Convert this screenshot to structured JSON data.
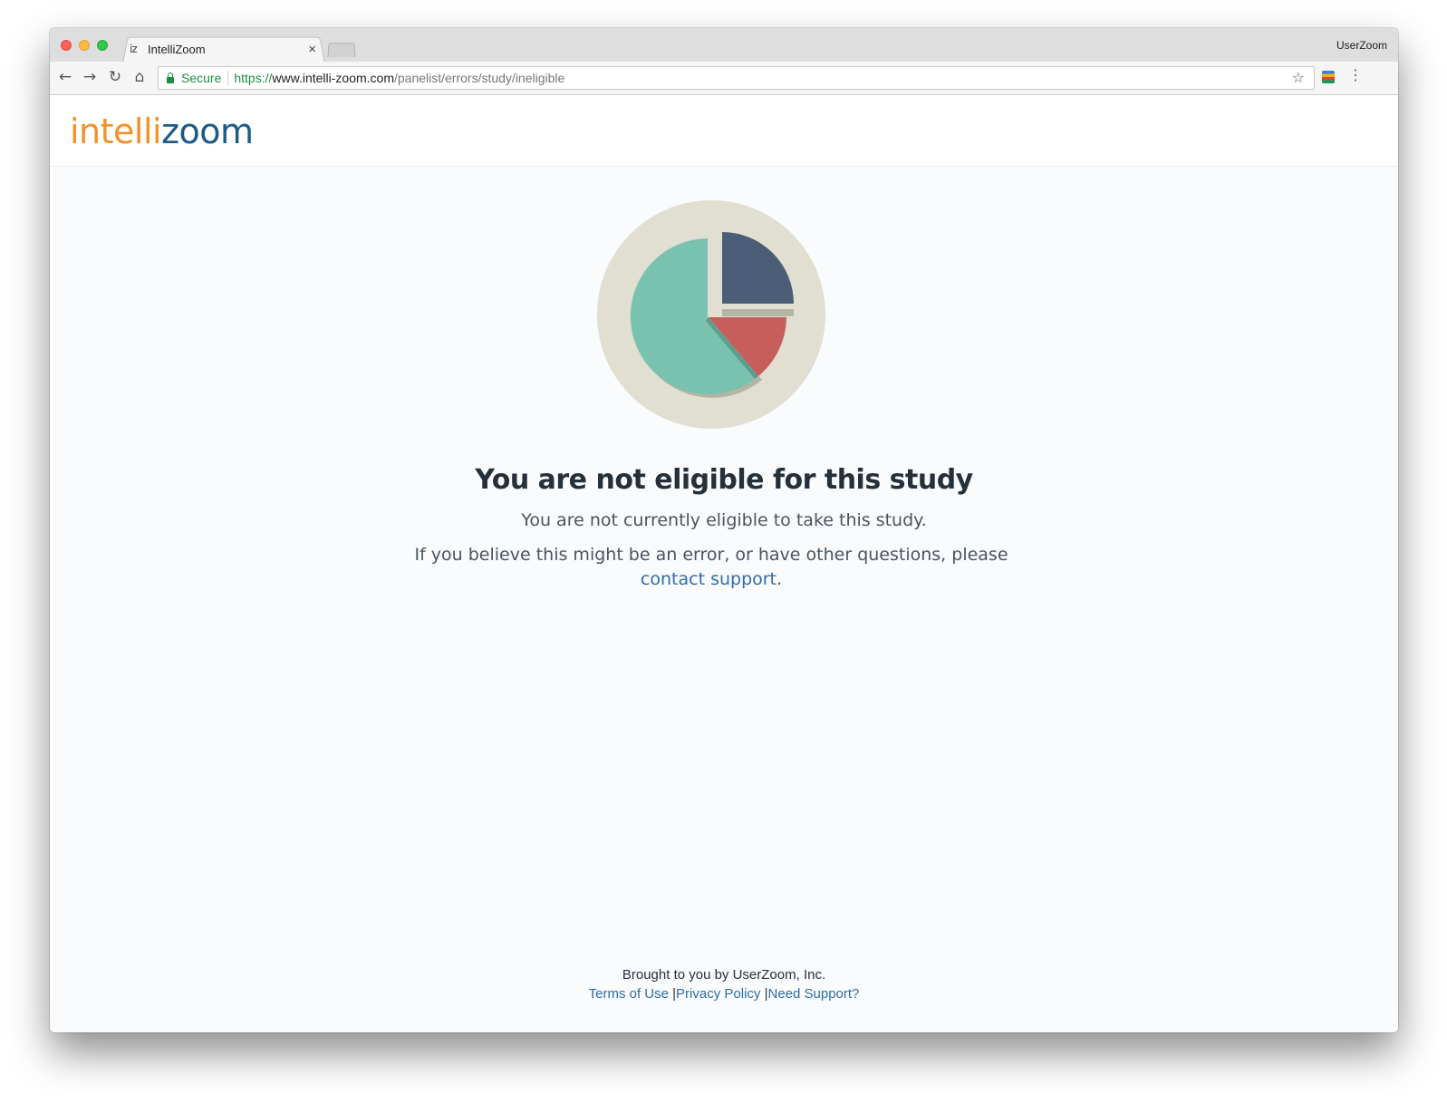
{
  "browser": {
    "tab_title": "IntelliZoom",
    "tab_favicon": "iz",
    "profile_name": "UserZoom",
    "secure_label": "Secure",
    "url_scheme": "https://",
    "url_host": "www.intelli-zoom.com",
    "url_path": "/panelist/errors/study/ineligible"
  },
  "header": {
    "logo_part1": "intelli",
    "logo_part2": "zoom"
  },
  "illustration": {
    "icon": "pie-chart-icon",
    "colors": {
      "background_circle": "#e0dfd1",
      "teal": "#78c2af",
      "navy": "#4c5d78",
      "red": "#c65e5c",
      "shadow": "#b5b4a5"
    }
  },
  "main": {
    "headline": "You are not eligible for this study",
    "subtext": "You are not currently eligible to take this study.",
    "help_prefix": "If you believe this might be an error, or have other questions, please ",
    "help_link": "contact support",
    "help_suffix": "."
  },
  "footer": {
    "credit": "Brought to you by UserZoom, Inc.",
    "terms": "Terms of Use",
    "privacy": "Privacy Policy",
    "support": "Need Support?",
    "divider": "|"
  },
  "colors": {
    "link": "#2e6da4",
    "logo_orange": "#f3922c",
    "logo_blue": "#1d5a85",
    "headline": "#25303b"
  }
}
